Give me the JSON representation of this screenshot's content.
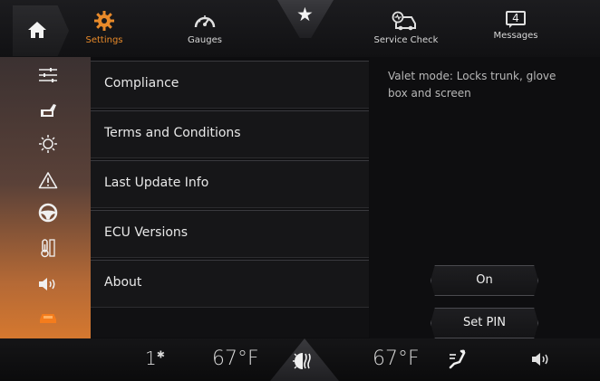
{
  "topbar": {
    "settings_label": "Settings",
    "gauges_label": "Gauges",
    "service_label": "Service Check",
    "messages_label": "Messages",
    "messages_count": "4",
    "favorite_glyph": "★",
    "active_color": "#e88a2a"
  },
  "sidebar": {
    "icons": [
      "sliders-icon",
      "car-seat-icon",
      "brightness-icon",
      "warning-icon",
      "steering-wheel-icon",
      "thermometer-icon",
      "speaker-icon",
      "car-icon"
    ]
  },
  "menu": {
    "items": [
      {
        "label": "Compliance"
      },
      {
        "label": "Terms and Conditions"
      },
      {
        "label": "Last Update Info"
      },
      {
        "label": "ECU Versions"
      },
      {
        "label": "About"
      }
    ]
  },
  "panel": {
    "valet_text": "Valet mode: Locks trunk, glove box and screen",
    "on_label": "On",
    "set_pin_label": "Set PIN"
  },
  "bottombar": {
    "fan_level": "1",
    "temp_left": "67°F",
    "temp_right": "67°F"
  }
}
